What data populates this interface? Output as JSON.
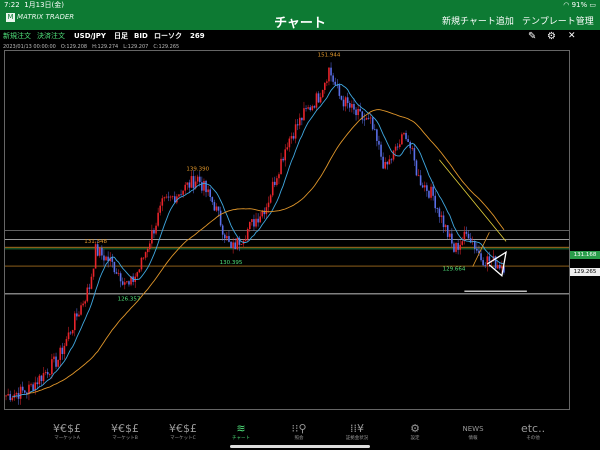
{
  "status": {
    "time": "7:22",
    "date": "1月13日(金)",
    "battery": "91%"
  },
  "header": {
    "logo": "MATRIX TRADER",
    "title": "チャート",
    "add_chart": "新規チャート追加",
    "template": "テンプレート管理"
  },
  "toolbar": {
    "new_order": "新規注文",
    "settle_order": "決済注文",
    "pair": "USD/JPY",
    "period": "日足",
    "side": "BID",
    "chart_kind": "ローソク",
    "count": "269"
  },
  "ohlc": "2023/01/13 00:00:00　O:129.208　H:129.274　L:129.207　C:129.265",
  "chart_data": {
    "type": "candlestick",
    "annotations": [
      {
        "label": "151.944",
        "x": 155,
        "y": 151.944
      },
      {
        "label": "139.390",
        "x": 92,
        "y": 139.39
      },
      {
        "label": "131.348",
        "x": 43,
        "y": 131.348
      },
      {
        "label": "130.395",
        "x": 108,
        "y": 130.395
      },
      {
        "label": "126.357",
        "x": 59,
        "y": 126.357
      },
      {
        "label": "129.664",
        "x": 215,
        "y": 129.664
      }
    ],
    "price_labels": [
      "131.168",
      "129.265"
    ],
    "ylim": [
      113.5,
      153
    ],
    "colors": {
      "up": "#e8242b",
      "down": "#5a6ee8",
      "ma_short": "#3fa7e0",
      "ma_long": "#e0962a"
    }
  },
  "nav": [
    {
      "icon": "¥€$£",
      "label": "マーケットA"
    },
    {
      "icon": "¥€$£",
      "label": "マーケットB"
    },
    {
      "icon": "¥€$£",
      "label": "マーケットC"
    },
    {
      "icon": "≋",
      "label": "チャート"
    },
    {
      "icon": "⁝⁝⚲",
      "label": "照会"
    },
    {
      "icon": "⁞⁞¥",
      "label": "証拠金状況"
    },
    {
      "icon": "⚙",
      "label": "設定"
    },
    {
      "icon": "NEWS",
      "label": "情報"
    },
    {
      "icon": "etc..",
      "label": "その他"
    }
  ]
}
